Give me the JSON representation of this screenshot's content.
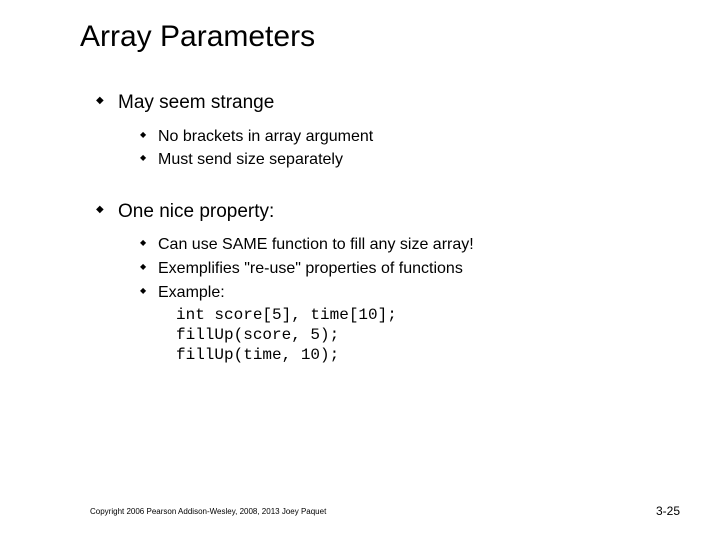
{
  "title": "Array Parameters",
  "bullets": {
    "b1": {
      "text": "May seem strange",
      "sub": {
        "s1": "No brackets in array argument",
        "s2": "Must send size separately"
      }
    },
    "b2": {
      "text": "One nice property:",
      "sub": {
        "s1": "Can use SAME function to fill any size array!",
        "s2": "Exemplifies \"re-use\" properties of functions",
        "s3": "Example:",
        "code1": "int score[5], time[10];",
        "code2": "fillUp(score, 5);",
        "code3": "fillUp(time, 10);"
      }
    }
  },
  "footer": {
    "left": "Copyright 2006 Pearson Addison-Wesley, 2008, 2013 Joey Paquet",
    "right": "3-25"
  }
}
